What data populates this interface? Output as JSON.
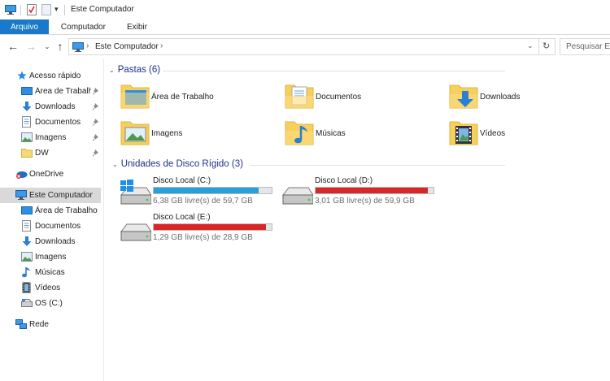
{
  "window": {
    "title": "Este Computador"
  },
  "ribbon": {
    "tabs": [
      {
        "label": "Arquivo",
        "active": true
      },
      {
        "label": "Computador",
        "active": false
      },
      {
        "label": "Exibir",
        "active": false
      }
    ]
  },
  "address": {
    "crumb": "Este Computador",
    "search_placeholder": "Pesquisar Este Computador"
  },
  "sidebar": {
    "quick_access": "Acesso rápido",
    "quick_items": [
      {
        "label": "Área de Trabalho",
        "icon": "desktop-icon",
        "pinned": true
      },
      {
        "label": "Downloads",
        "icon": "download-icon",
        "pinned": true
      },
      {
        "label": "Documentos",
        "icon": "documents-icon",
        "pinned": true
      },
      {
        "label": "Imagens",
        "icon": "pictures-icon",
        "pinned": true
      },
      {
        "label": "DW",
        "icon": "folder-icon",
        "pinned": true
      }
    ],
    "onedrive": "OneDrive",
    "this_pc": "Este Computador",
    "pc_items": [
      {
        "label": "Área de Trabalho",
        "icon": "desktop-icon"
      },
      {
        "label": "Documentos",
        "icon": "documents-icon"
      },
      {
        "label": "Downloads",
        "icon": "download-icon"
      },
      {
        "label": "Imagens",
        "icon": "pictures-icon"
      },
      {
        "label": "Músicas",
        "icon": "music-icon"
      },
      {
        "label": "Vídeos",
        "icon": "videos-icon"
      },
      {
        "label": "OS (C:)",
        "icon": "drive-icon"
      }
    ],
    "network": "Rede"
  },
  "content": {
    "folders_header": "Pastas (6)",
    "folders": [
      {
        "label": "Área de Trabalho",
        "icon": "desktop-folder-icon"
      },
      {
        "label": "Documentos",
        "icon": "documents-folder-icon"
      },
      {
        "label": "Downloads",
        "icon": "downloads-folder-icon"
      },
      {
        "label": "Imagens",
        "icon": "pictures-folder-icon"
      },
      {
        "label": "Músicas",
        "icon": "music-folder-icon"
      },
      {
        "label": "Vídeos",
        "icon": "videos-folder-icon"
      }
    ],
    "drives_header": "Unidades de Disco Rígido (3)",
    "drives": [
      {
        "name": "Disco Local (C:)",
        "info": "6,38 GB livre(s) de 59,7 GB",
        "used_fraction": 0.89,
        "color": "#26a0da",
        "windows": true
      },
      {
        "name": "Disco Local (D:)",
        "info": "3,01 GB livre(s) de 59,9 GB",
        "used_fraction": 0.95,
        "color": "#da2626",
        "windows": false
      },
      {
        "name": "Disco Local (E:)",
        "info": "1,29 GB livre(s) de 28,9 GB",
        "used_fraction": 0.955,
        "color": "#da2626",
        "windows": false
      }
    ]
  }
}
